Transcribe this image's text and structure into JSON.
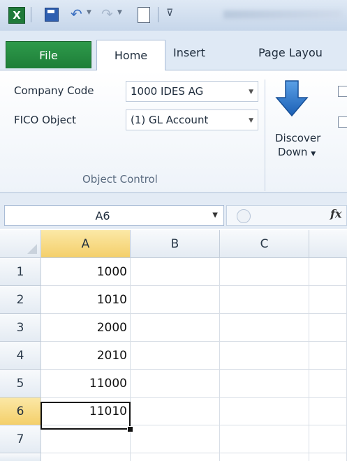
{
  "quick_access": {
    "logo_letter": "X",
    "icons": [
      "excel-icon",
      "save-icon",
      "undo-icon",
      "redo-icon",
      "new-document-icon",
      "customize-qat-icon"
    ]
  },
  "tabs": {
    "file": "File",
    "home": "Home",
    "insert": "Insert",
    "page_layout": "Page Layou"
  },
  "ribbon": {
    "company_code_label": "Company Code",
    "company_code_value": "1000 IDES AG",
    "fico_object_label": "FICO Object",
    "fico_object_value": "(1) GL Account",
    "group_label": "Object Control",
    "discover_label_line1": "Discover",
    "discover_label_line2": "Down"
  },
  "formula_bar": {
    "name_box": "A6",
    "fx_label": "fx",
    "formula": ""
  },
  "sheet": {
    "columns": [
      "A",
      "B",
      "C"
    ],
    "selected_column": "A",
    "rows": [
      {
        "num": "1",
        "a": "1000"
      },
      {
        "num": "2",
        "a": "1010"
      },
      {
        "num": "3",
        "a": "2000"
      },
      {
        "num": "4",
        "a": "2010"
      },
      {
        "num": "5",
        "a": "11000"
      },
      {
        "num": "6",
        "a": "11010"
      },
      {
        "num": "7",
        "a": ""
      }
    ],
    "active_cell": "A6"
  },
  "colors": {
    "file_tab": "#1e7e38",
    "selected_header": "#f4cf6a",
    "ribbon_bg": "#dfe9f5"
  }
}
